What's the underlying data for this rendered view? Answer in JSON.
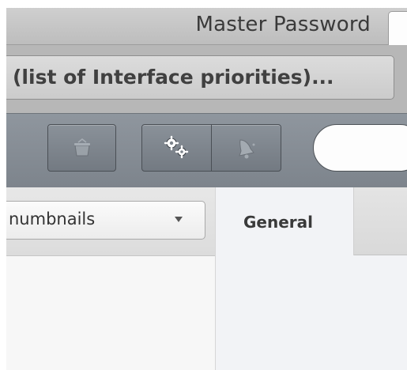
{
  "window": {
    "title": "Master Password"
  },
  "path_bar": {
    "text": "(list of Interface priorities)..."
  },
  "toolbar": {
    "buttons": [
      {
        "name": "trash",
        "icon": "trash-icon"
      },
      {
        "name": "settings",
        "icon": "gear-icon"
      },
      {
        "name": "notifications",
        "icon": "bell-icon"
      }
    ],
    "search": {
      "value": "",
      "placeholder": ""
    }
  },
  "content": {
    "view_select": {
      "selected": "numbnails"
    },
    "tabs": [
      {
        "label": "General",
        "active": true
      }
    ]
  },
  "colors": {
    "toolbar": "#858c94",
    "pane_background": "#f2f3f6",
    "tab_bar": "#bdbdbd"
  }
}
